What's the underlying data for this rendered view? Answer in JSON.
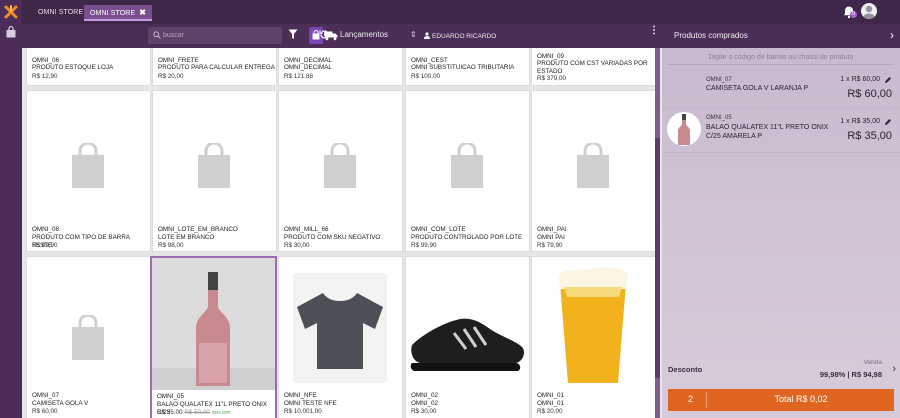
{
  "tabs": [
    {
      "label": "OMNI STORE"
    },
    {
      "label": "OMNI STORE",
      "close": "✖"
    }
  ],
  "toolbar": {
    "search_placeholder": "buscar",
    "dropdown_label": "Lançamentos",
    "dropdown_arrow": "⇕",
    "user_name": "EDUARDO RICARDO",
    "more": "⋮"
  },
  "notification_badge": "0",
  "products": [
    {
      "code": "OMNI_06",
      "name": "PRODUTO ESTOQUE LOJA",
      "price": "R$ 12,90"
    },
    {
      "code": "OMNI_FRETE",
      "name": "PRODUTO PARA CALCULAR ENTREGA",
      "price": "R$ 20,00"
    },
    {
      "code": "OMNI_DECIMAL",
      "name": "OMNI_DECIMAL",
      "price": "R$ 121,88"
    },
    {
      "code": "OMNI_CEST",
      "name": "OMNI SUBSTITUICAO TRIBUTARIA",
      "price": "R$ 100,00"
    },
    {
      "code": "OMNI_09",
      "name": "PRODUTO COM CST VARIADAS POR ESTADO",
      "price": "R$ 379,00"
    },
    {
      "code": "OMNI_08",
      "name": "PRODUTO COM TIPO DE BARRA TESTE",
      "price": "R$ 89,90"
    },
    {
      "code": "OMNI_LOTE_EM_BRANCO",
      "name": "LOTE EM BRANCO",
      "price": "R$ 98,00"
    },
    {
      "code": "OMNI_MILL_66",
      "name": "PRODUTO COM SKU NEGATIVO",
      "price": "R$ 30,00"
    },
    {
      "code": "OMNI_COM_LOTE",
      "name": "PRODUTO CONTROLADO POR LOTE",
      "price": "R$ 99,90"
    },
    {
      "code": "OMNI_PAI",
      "name": "OMNI PAI",
      "price": "R$ 79,90"
    },
    {
      "code": "OMNI_07",
      "name": "CAMISETA GOLA V",
      "price": "R$ 60,00"
    },
    {
      "code": "OMNI_05",
      "name": "BALAO QUALATEX 11\"L PRETO ONIX C/25",
      "price": "R$ 35,00",
      "old_price": "R$ 50,00",
      "promo": "35% OFF"
    },
    {
      "code": "OMNI_NFE",
      "name": "OMNI TESTE NFE",
      "price": "R$ 10.001,00"
    },
    {
      "code": "OMNI_02",
      "name": "OMNI_02",
      "price": "R$ 30,00"
    },
    {
      "code": "OMNI_01",
      "name": "OMNI_01",
      "price": "R$ 20,00"
    }
  ],
  "cart": {
    "title": "Produtos comprados",
    "barcode_placeholder": "Digite o código de barras ou chassi do produto",
    "items": [
      {
        "code": "OMNI_07",
        "desc": "CAMISETA GOLA V LARANJA P",
        "qty": "1 x R$ 60,00",
        "value": "R$ 60,00"
      },
      {
        "code": "OMNI_05",
        "desc": "BALAO QUALATEX 11\"L PRETO ONIX C/25 AMARELA P",
        "qty": "1 x R$ 35,00",
        "value": "R$ 35,00"
      }
    ],
    "discount_label": "Desconto",
    "venda_label": "Venda",
    "venda_value": "99,98% | R$ 94,98",
    "total_qty": "2",
    "total_label": "Total R$ 0,02"
  },
  "colors": {
    "accent": "#7b46b5",
    "total_button": "#e0661f",
    "rail": "#4c2c58",
    "header": "#3e2748"
  }
}
